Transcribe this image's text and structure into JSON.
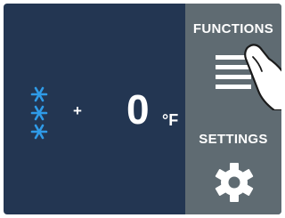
{
  "display": {
    "mode_icon": "snowflake-icon",
    "sign": "+",
    "temperature": "0",
    "unit": "°F"
  },
  "panel": {
    "functions_label": "FUNCTIONS",
    "functions_icon": "menu-icon",
    "settings_label": "SETTINGS",
    "settings_icon": "gear-icon"
  },
  "colors": {
    "screen_bg": "#233652",
    "panel_bg": "#5f6b72",
    "snowflake": "#2f9be8",
    "text": "#ffffff"
  }
}
